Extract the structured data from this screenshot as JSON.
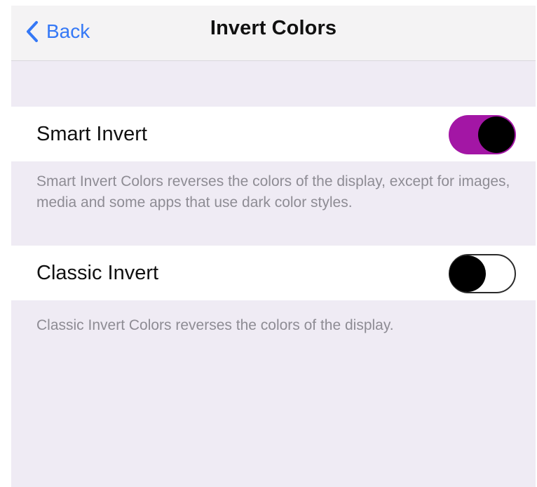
{
  "nav": {
    "back_label": "Back",
    "title": "Invert Colors"
  },
  "settings": [
    {
      "label": "Smart Invert",
      "on": true,
      "footer": "Smart Invert Colors reverses the colors of the display, except for images, media and some apps that use dark color styles."
    },
    {
      "label": "Classic Invert",
      "on": false,
      "footer": "Classic Invert Colors reverses the colors of the display."
    }
  ],
  "colors": {
    "accent": "#3478f6",
    "toggle_on": "#a316a5",
    "background": "#efebf4"
  },
  "icons": {
    "back": "chevron-left-icon"
  }
}
